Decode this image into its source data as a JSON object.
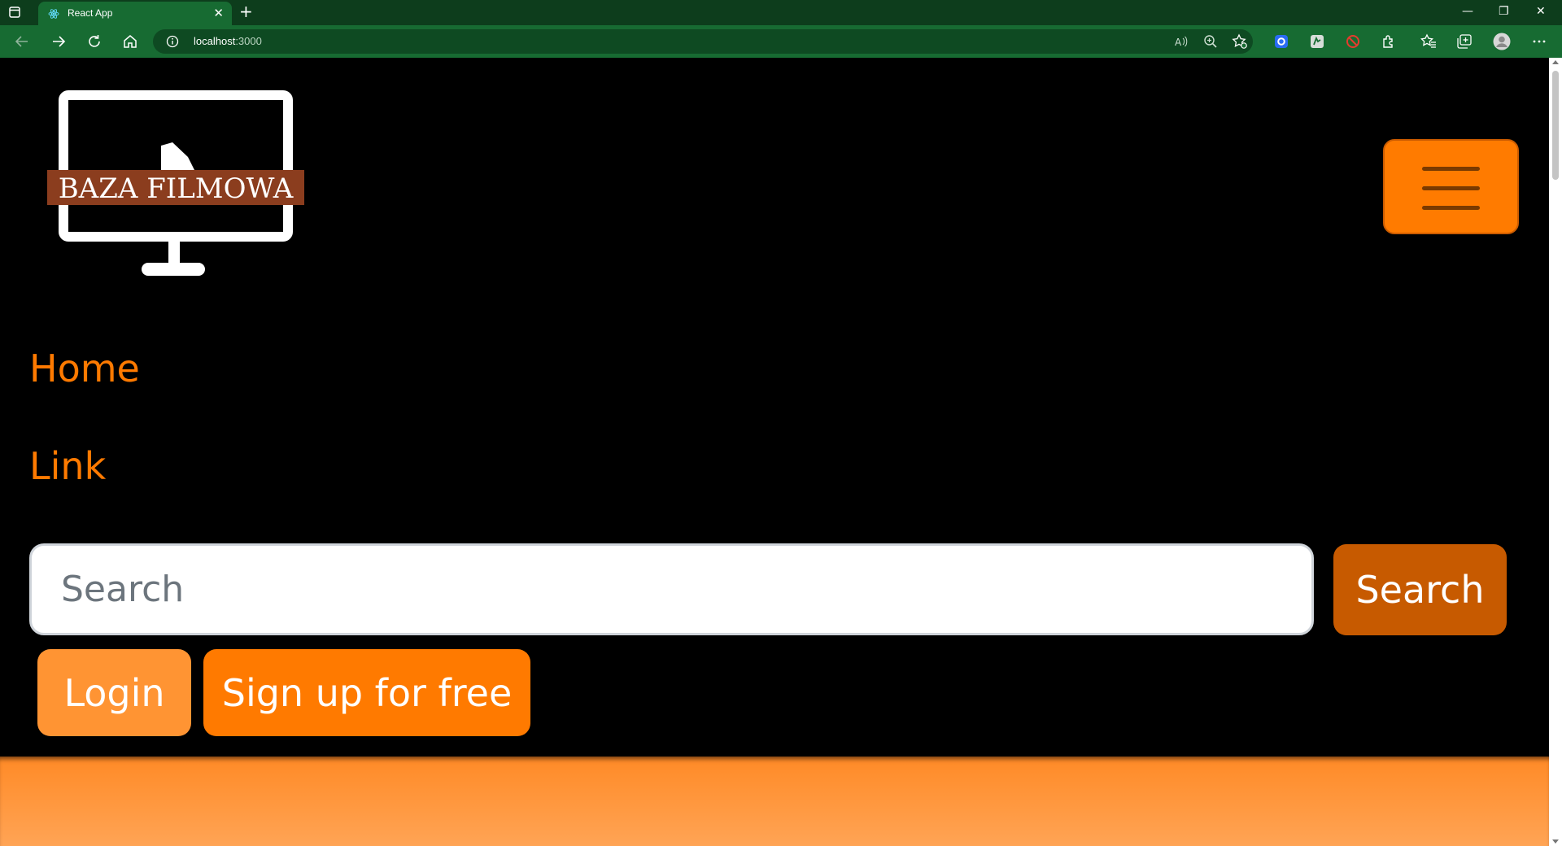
{
  "browser": {
    "tab_title": "React App",
    "tab_close": "✕",
    "new_tab": "+",
    "url_host": "localhost",
    "url_port": ":3000",
    "window_controls": {
      "minimize": "—",
      "restore": "❐",
      "close": "✕"
    },
    "toolbar_icons": [
      "read-aloud-icon",
      "zoom-icon",
      "add-favorite-icon",
      "extension-blue-icon",
      "extension-gray-icon",
      "blocked-icon",
      "extensions-icon",
      "favorites-icon",
      "collections-icon",
      "profile-icon",
      "more-icon"
    ]
  },
  "app": {
    "brand": "BAZA FILMOWA",
    "nav": {
      "home": "Home",
      "link": "Link"
    },
    "search": {
      "placeholder": "Search",
      "button": "Search"
    },
    "auth": {
      "login": "Login",
      "signup": "Sign up for free"
    }
  },
  "colors": {
    "accent": "#ff7a00",
    "search_button": "#c75a00",
    "login_button": "#ff9433",
    "logo_banner": "#8b3d1e",
    "browser_frame": "#176b32"
  }
}
